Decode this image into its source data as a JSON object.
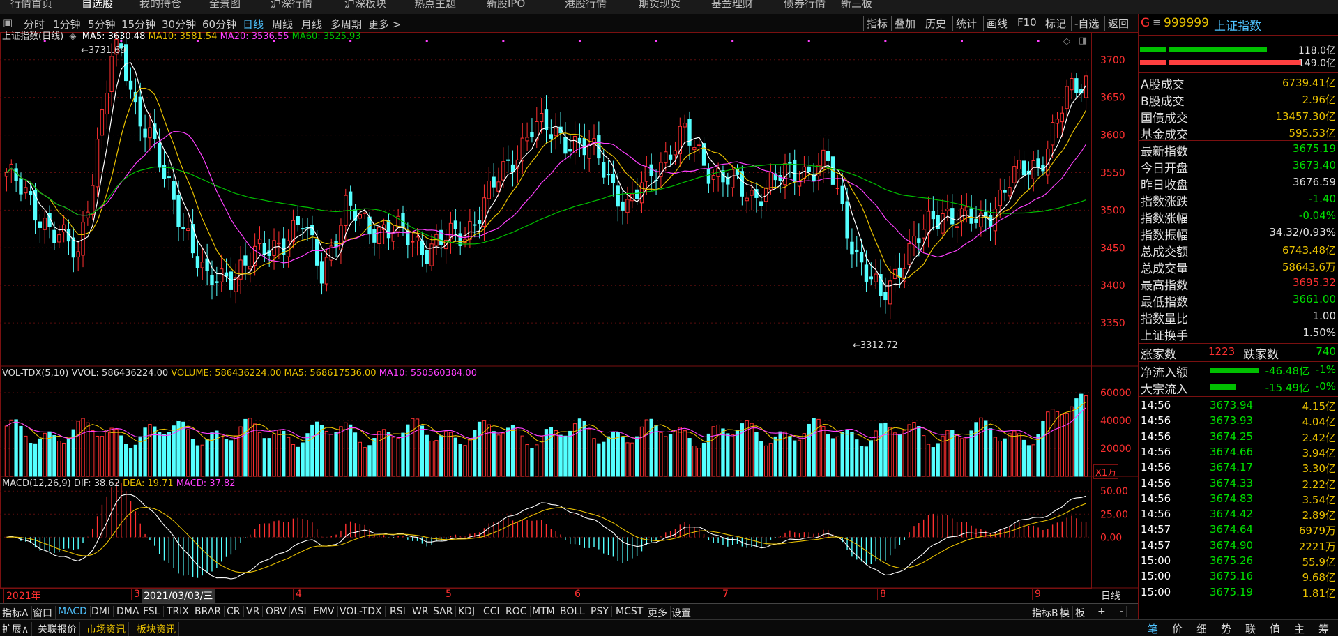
{
  "top_tabs": [
    "行情首页",
    "自选股",
    "我的持仓",
    "全景图",
    "沪深行情",
    "沪深板块",
    "热点主题",
    "新股IPO",
    "港股行情",
    "期货现货",
    "基金理财",
    "债券行情",
    "新三板"
  ],
  "toolbar": {
    "periods": [
      "分时",
      "1分钟",
      "5分钟",
      "15分钟",
      "30分钟",
      "60分钟",
      "日线",
      "周线",
      "月线",
      "多周期",
      "更多 >"
    ],
    "selected": "日线",
    "right_buttons": [
      "指标",
      "叠加",
      "历史",
      "统计",
      "画线",
      "F10",
      "标记",
      "-自选",
      "返回"
    ]
  },
  "main_legend": {
    "title": "上证指数(日线)",
    "ma5": "MA5: 3630.48",
    "ma10": "MA10: 3581.54",
    "ma20": "MA20: 3536.55",
    "ma60": "MA60: 3525.93"
  },
  "annotations": {
    "high": "3731.69",
    "low": "3312.72"
  },
  "vol_legend": {
    "title": "VOL-TDX(5,10)",
    "vvol": "VVOL: 586436224.00",
    "volume": "VOLUME: 586436224.00",
    "ma5": "MA5: 568617536.00",
    "ma10": "MA10: 550560384.00",
    "unit": "X1万"
  },
  "macd_legend": {
    "title": "MACD(12,26,9)",
    "dif": "DIF: 38.62",
    "dea": "DEA: 19.71",
    "macd": "MACD: 37.82"
  },
  "x_axis": {
    "months": [
      "2021年",
      "3",
      "4",
      "5",
      "6",
      "7",
      "8",
      "9"
    ],
    "cursor": "2021/03/03/三",
    "period_label": "日线"
  },
  "colors": {
    "up": "#ff3030",
    "down": "#54ffff",
    "ma5": "#ffffff",
    "ma10": "#e8c000",
    "ma20": "#ff40ff",
    "ma60": "#00c000",
    "accent": "#4fc3ff"
  },
  "chart_data": {
    "type": "candlestick",
    "price_axis": {
      "ticks": [
        3350,
        3400,
        3450,
        3500,
        3550,
        3600,
        3650,
        3700
      ],
      "range": [
        3300,
        3710
      ]
    },
    "volume_axis": {
      "ticks": [
        20000,
        40000,
        60000
      ],
      "range": [
        0,
        68000
      ]
    },
    "macd_axis": {
      "ticks": [
        0.0,
        25.0,
        50.0
      ],
      "labels": [
        "0.00",
        "25.00",
        "50.00"
      ],
      "range": [
        -55,
        60
      ]
    },
    "series_close_anchor": [
      [
        0,
        3550
      ],
      [
        10,
        3470
      ],
      [
        15,
        3440
      ],
      [
        22,
        3700
      ],
      [
        24,
        3710
      ],
      [
        27,
        3640
      ],
      [
        30,
        3600
      ],
      [
        33,
        3540
      ],
      [
        38,
        3470
      ],
      [
        42,
        3400
      ],
      [
        48,
        3420
      ],
      [
        55,
        3450
      ],
      [
        62,
        3480
      ],
      [
        66,
        3420
      ],
      [
        71,
        3500
      ],
      [
        76,
        3480
      ],
      [
        82,
        3470
      ],
      [
        88,
        3450
      ],
      [
        96,
        3470
      ],
      [
        102,
        3530
      ],
      [
        110,
        3610
      ],
      [
        116,
        3600
      ],
      [
        124,
        3570
      ],
      [
        130,
        3500
      ],
      [
        136,
        3560
      ],
      [
        142,
        3600
      ],
      [
        148,
        3550
      ],
      [
        156,
        3520
      ],
      [
        164,
        3550
      ],
      [
        172,
        3560
      ],
      [
        178,
        3440
      ],
      [
        183,
        3380
      ],
      [
        188,
        3440
      ],
      [
        196,
        3500
      ],
      [
        204,
        3480
      ],
      [
        210,
        3540
      ],
      [
        216,
        3560
      ],
      [
        222,
        3650
      ],
      [
        226,
        3675
      ]
    ]
  },
  "panel": {
    "header_code": "999999",
    "header_name": "上证指数",
    "bar1_value": "118.0亿",
    "bar2_value": "149.0亿",
    "rows1": [
      {
        "k": "A股成交",
        "v": "6739.41亿",
        "c": "#e8c000"
      },
      {
        "k": "B股成交",
        "v": "2.96亿",
        "c": "#e8c000"
      },
      {
        "k": "国债成交",
        "v": "13457.30亿",
        "c": "#e8c000"
      },
      {
        "k": "基金成交",
        "v": "595.53亿",
        "c": "#e8c000"
      }
    ],
    "rows2": [
      {
        "k": "最新指数",
        "v": "3675.19",
        "c": "#00e000"
      },
      {
        "k": "今日开盘",
        "v": "3673.40",
        "c": "#00e000"
      },
      {
        "k": "昨日收盘",
        "v": "3676.59",
        "c": "#e0e0e0"
      },
      {
        "k": "指数涨跌",
        "v": "-1.40",
        "c": "#00e000"
      },
      {
        "k": "指数涨幅",
        "v": "-0.04%",
        "c": "#00e000"
      },
      {
        "k": "指数振幅",
        "v": "34.32/0.93%",
        "c": "#e0e0e0"
      },
      {
        "k": "总成交额",
        "v": "6743.48亿",
        "c": "#e8c000"
      },
      {
        "k": "总成交量",
        "v": "58643.6万",
        "c": "#e8c000"
      },
      {
        "k": "最高指数",
        "v": "3695.32",
        "c": "#ff3030"
      },
      {
        "k": "最低指数",
        "v": "3661.00",
        "c": "#00e000"
      },
      {
        "k": "指数量比",
        "v": "1.00",
        "c": "#e0e0e0"
      },
      {
        "k": "上证换手",
        "v": "1.50%",
        "c": "#e0e0e0"
      }
    ],
    "up_label": "涨家数",
    "up_value": "1223",
    "down_label": "跌家数",
    "down_value": "740",
    "flow": [
      {
        "k": "净流入额",
        "v": "-46.48亿",
        "p": "-1%"
      },
      {
        "k": "大宗流入",
        "v": "-15.49亿",
        "p": "-0%"
      }
    ],
    "ticks": [
      {
        "t": "14:56",
        "p": "3673.94",
        "v": "4.15亿"
      },
      {
        "t": "14:56",
        "p": "3673.93",
        "v": "4.04亿"
      },
      {
        "t": "14:56",
        "p": "3674.25",
        "v": "2.42亿"
      },
      {
        "t": "14:56",
        "p": "3674.66",
        "v": "3.94亿"
      },
      {
        "t": "14:56",
        "p": "3674.17",
        "v": "3.30亿"
      },
      {
        "t": "14:56",
        "p": "3674.33",
        "v": "2.22亿"
      },
      {
        "t": "14:56",
        "p": "3674.83",
        "v": "3.54亿"
      },
      {
        "t": "14:56",
        "p": "3674.42",
        "v": "2.89亿"
      },
      {
        "t": "14:57",
        "p": "3674.64",
        "v": "6979万"
      },
      {
        "t": "14:57",
        "p": "3674.90",
        "v": "2221万"
      },
      {
        "t": "15:00",
        "p": "3675.26",
        "v": "55.9亿"
      },
      {
        "t": "15:00",
        "p": "3675.16",
        "v": "9.68亿"
      },
      {
        "t": "15:00",
        "p": "3675.19",
        "v": "1.81亿"
      }
    ],
    "bottom_tabs": [
      "笔",
      "价",
      "细",
      "势",
      "联",
      "值",
      "主",
      "筹"
    ]
  },
  "indicator_tabs": [
    "指标A",
    "窗口",
    "MACD",
    "DMI",
    "DMA",
    "FSL",
    "TRIX",
    "BRAR",
    "CR",
    "VR",
    "OBV",
    "ASI",
    "EMV",
    "VOL-TDX",
    "RSI",
    "WR",
    "SAR",
    "KDJ",
    "CCI",
    "ROC",
    "MTM",
    "BOLL",
    "PSY",
    "MCST",
    "更多",
    "设置"
  ],
  "indicator_selected": "MACD",
  "indicator_right": [
    "指标B",
    "模",
    "板",
    "+",
    "-"
  ],
  "bottom_links": [
    "扩展∧",
    "关联报价",
    "市场资讯",
    "板块资讯"
  ]
}
